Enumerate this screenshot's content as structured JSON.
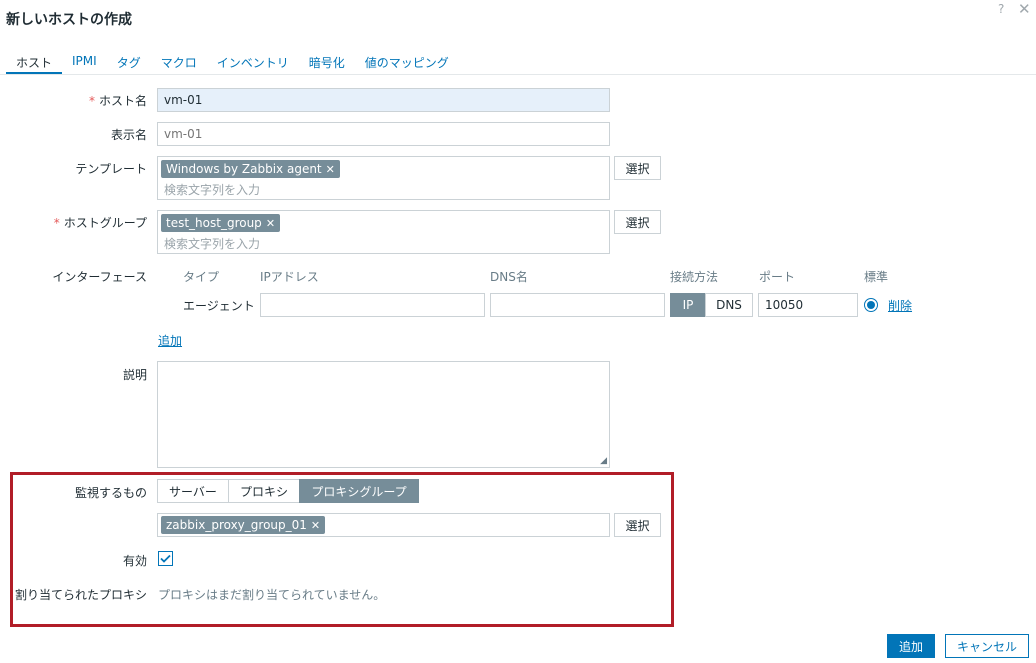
{
  "dialog": {
    "title": "新しいホストの作成",
    "help": "?",
    "close": "✕"
  },
  "tabs": [
    {
      "label": "ホスト"
    },
    {
      "label": "IPMI"
    },
    {
      "label": "タグ"
    },
    {
      "label": "マクロ"
    },
    {
      "label": "インベントリ"
    },
    {
      "label": "暗号化"
    },
    {
      "label": "値のマッピング"
    }
  ],
  "form": {
    "host_name": {
      "required": "*",
      "label": "ホスト名",
      "value": "vm-01"
    },
    "visible_name": {
      "label": "表示名",
      "placeholder": "vm-01"
    },
    "templates": {
      "label": "テンプレート",
      "chip": "Windows by Zabbix agent",
      "placeholder": "検索文字列を入力",
      "select_button": "選択"
    },
    "host_groups": {
      "required": "*",
      "label": "ホストグループ",
      "chip": "test_host_group",
      "placeholder": "検索文字列を入力",
      "select_button": "選択"
    },
    "interfaces": {
      "label": "インターフェース",
      "headers": {
        "type": "タイプ",
        "ip": "IPアドレス",
        "dns": "DNS名",
        "connect": "接続方法",
        "port": "ポート",
        "default": "標準"
      },
      "row": {
        "type": "エージェント",
        "ip": "",
        "dns": "",
        "connect_ip": "IP",
        "connect_dns": "DNS",
        "connect_selected": "IP",
        "port": "10050",
        "remove": "削除"
      },
      "add": "追加"
    },
    "description": {
      "label": "説明",
      "value": ""
    },
    "monitored_by": {
      "label": "監視するもの",
      "options": [
        "サーバー",
        "プロキシ",
        "プロキシグループ"
      ],
      "selected": "プロキシグループ",
      "chip": "zabbix_proxy_group_01",
      "select_button": "選択"
    },
    "enabled": {
      "label": "有効",
      "checked": true
    },
    "assigned_proxy": {
      "label": "割り当てられたプロキシ",
      "value": "プロキシはまだ割り当てられていません。"
    }
  },
  "footer": {
    "add": "追加",
    "cancel": "キャンセル"
  },
  "colors": {
    "accent": "#0275b8",
    "chip": "#768d99",
    "highlight_border": "#b11d27",
    "required": "#e45959"
  },
  "icons": [
    "help-icon",
    "close-icon",
    "chip-remove-icon",
    "resize-grip-icon",
    "check-icon"
  ]
}
